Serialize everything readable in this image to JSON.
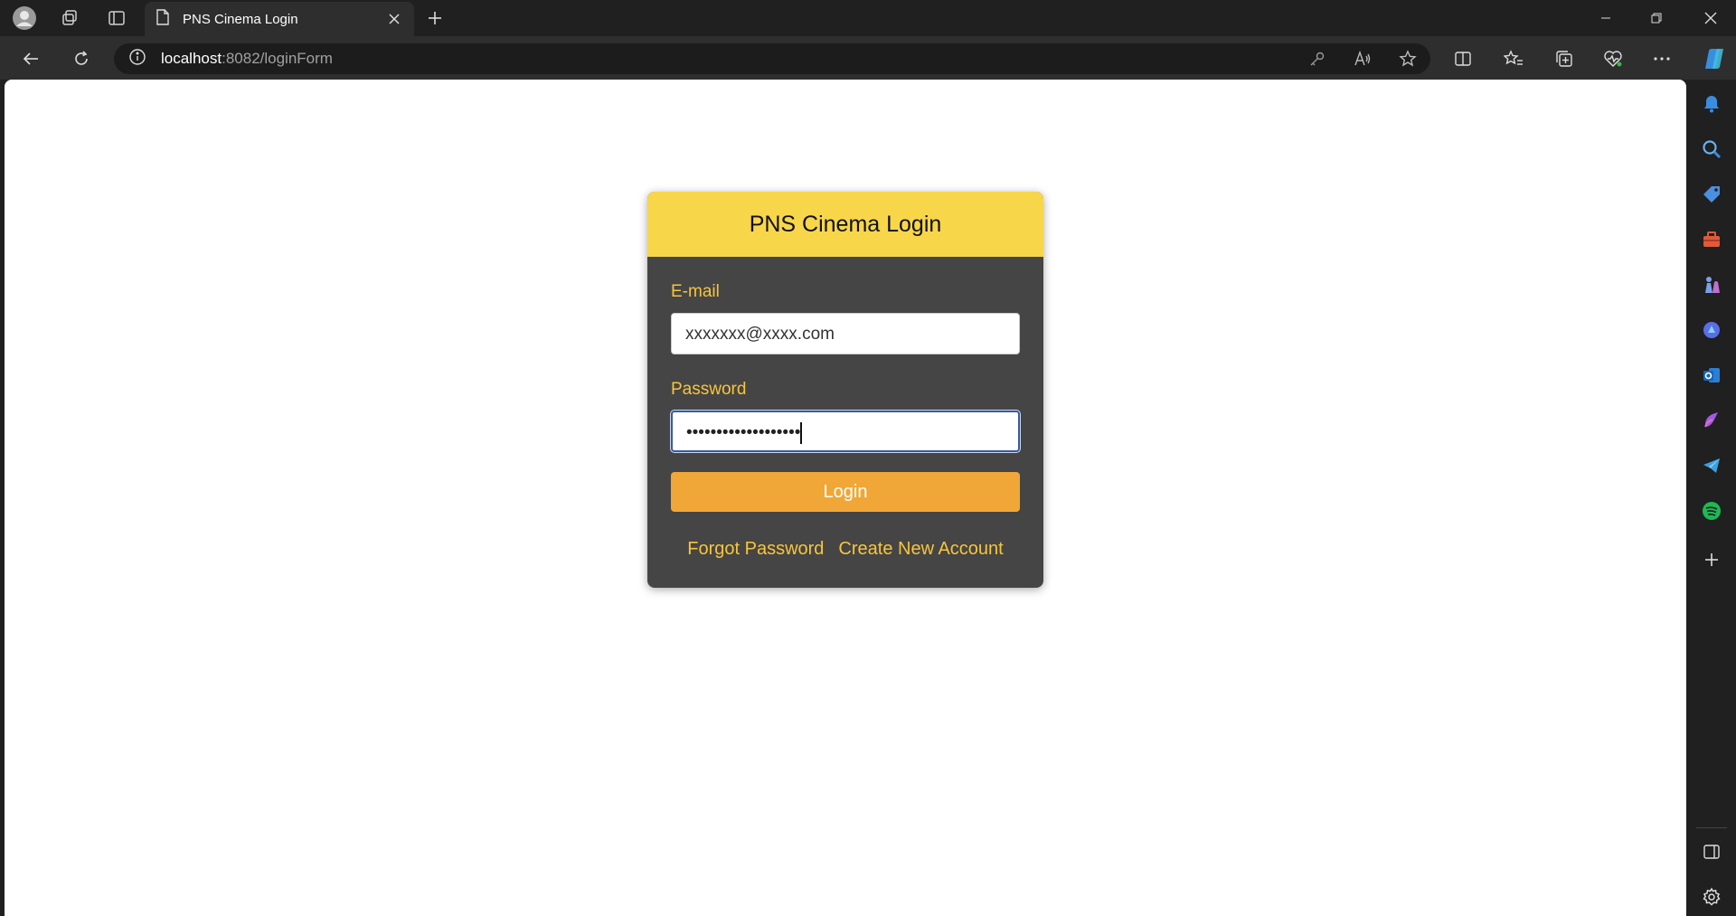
{
  "browser": {
    "tab_title": "PNS Cinema Login",
    "url_host": "localhost",
    "url_rest": ":8082/loginForm"
  },
  "page": {
    "header_title": "PNS Cinema Login",
    "email_label": "E-mail",
    "email_value": "xxxxxxx@xxxx.com",
    "password_label": "Password",
    "password_value": "•••••••••••••••••••",
    "login_label": "Login",
    "forgot_link": "Forgot Password",
    "create_link": "Create New Account"
  },
  "colors": {
    "header": "#f8d64a",
    "card": "#454545",
    "accent_text": "#f8c53a",
    "button": "#f0a737"
  }
}
